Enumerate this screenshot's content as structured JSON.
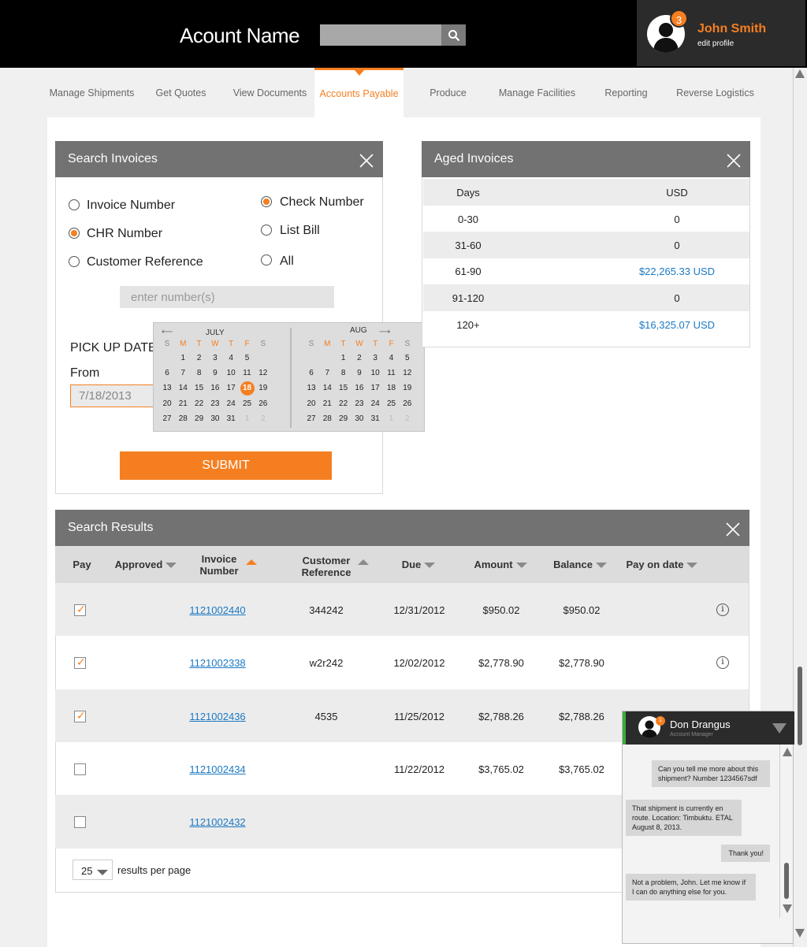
{
  "header": {
    "account_name": "Acount Name",
    "search_placeholder": "",
    "user_name": "John Smith",
    "edit_profile": "edit profile",
    "notification_count": "3"
  },
  "nav": {
    "items": [
      {
        "label": "Manage Shipments"
      },
      {
        "label": "Get Quotes"
      },
      {
        "label": "View Documents"
      },
      {
        "label": "Accounts Payable"
      },
      {
        "label": "Produce"
      },
      {
        "label": "Manage Facilities"
      },
      {
        "label": "Reporting"
      },
      {
        "label": "Reverse Logistics"
      }
    ],
    "active": "Accounts Payable"
  },
  "search_invoices": {
    "title": "Search Invoices",
    "options": [
      {
        "label": "Invoice Number",
        "selected": false
      },
      {
        "label": "CHR Number",
        "selected": true
      },
      {
        "label": "Customer Reference",
        "selected": false
      },
      {
        "label": "Check Number",
        "selected": true
      },
      {
        "label": "List Bill",
        "selected": false
      },
      {
        "label": "All",
        "selected": false
      }
    ],
    "number_placeholder": "enter number(s)",
    "pickup_label": "PICK UP DATE",
    "from_label": "From",
    "from_value": "7/18/2013",
    "submit_label": "SUBMIT"
  },
  "calendar": {
    "left": {
      "month": "JULY",
      "dow": [
        "S",
        "M",
        "T",
        "W",
        "T",
        "F",
        "S"
      ],
      "weeks": [
        [
          "",
          "1",
          "2",
          "3",
          "4",
          "5",
          ""
        ],
        [
          "6",
          "7",
          "8",
          "9",
          "10",
          "11",
          "12"
        ],
        [
          "13",
          "14",
          "15",
          "16",
          "17",
          "18",
          "19"
        ],
        [
          "20",
          "21",
          "22",
          "23",
          "24",
          "25",
          "26"
        ],
        [
          "27",
          "28",
          "29",
          "30",
          "31",
          "1",
          "2"
        ]
      ],
      "selected": "18"
    },
    "right": {
      "month": "AUG",
      "dow": [
        "S",
        "M",
        "T",
        "W",
        "T",
        "F",
        "S"
      ],
      "weeks": [
        [
          "",
          "",
          "",
          "1",
          "2",
          "3",
          "4",
          "5"
        ],
        [
          "6",
          "7",
          "8",
          "9",
          "10",
          "11",
          "12"
        ],
        [
          "13",
          "14",
          "15",
          "16",
          "17",
          "18",
          "19"
        ],
        [
          "20",
          "21",
          "22",
          "23",
          "24",
          "25",
          "26"
        ],
        [
          "27",
          "28",
          "29",
          "30",
          "31",
          "1",
          "2"
        ]
      ]
    }
  },
  "aged_invoices": {
    "title": "Aged Invoices",
    "col_days": "Days",
    "col_usd": "USD",
    "rows": [
      {
        "days": "0-30",
        "usd": "0",
        "link": false
      },
      {
        "days": "31-60",
        "usd": "0",
        "link": false
      },
      {
        "days": "61-90",
        "usd": "$22,265.33 USD",
        "link": true
      },
      {
        "days": "91-120",
        "usd": "0",
        "link": false
      },
      {
        "days": "120+",
        "usd": "$16,325.07 USD",
        "link": true
      }
    ]
  },
  "results": {
    "title": "Search Results",
    "headers": {
      "pay": "Pay",
      "approved": "Approved",
      "invoice_number": "Invoice Number",
      "customer_reference": "Customer Reference",
      "due": "Due",
      "amount": "Amount",
      "balance": "Balance",
      "pay_on_date": "Pay on date"
    },
    "rows": [
      {
        "checked": true,
        "invoice": "1121002440",
        "ref": "344242",
        "due": "12/31/2012",
        "amount": "$950.02",
        "balance": "$950.02"
      },
      {
        "checked": true,
        "invoice": "1121002338",
        "ref": "w2r242",
        "due": "12/02/2012",
        "amount": "$2,778.90",
        "balance": "$2,778.90"
      },
      {
        "checked": true,
        "invoice": "1121002436",
        "ref": "4535",
        "due": "11/25/2012",
        "amount": "$2,788.26",
        "balance": "$2,788.26"
      },
      {
        "checked": false,
        "invoice": "1121002434",
        "ref": "",
        "due": "11/22/2012",
        "amount": "$3,765.02",
        "balance": "$3,765.02"
      },
      {
        "checked": false,
        "invoice": "1121002432",
        "ref": "",
        "due": "",
        "amount": "",
        "balance": ""
      }
    ],
    "per_page_value": "25",
    "per_page_label": "results per page",
    "info_glyph": "i"
  },
  "chat": {
    "name": "Don Drangus",
    "role": "Account Manager",
    "badge": "1",
    "messages": [
      {
        "from": "user",
        "text": "Can you tell me more about this shipment? Number 1234567sdf"
      },
      {
        "from": "agent",
        "text": "That shipment is currently en route. Location: Timbuktu. ETAL August 8, 2013."
      },
      {
        "from": "user",
        "text": "Thank you!"
      },
      {
        "from": "agent",
        "text": "Not a problem, John. Let me know if I can do anything else for you."
      }
    ]
  },
  "colors": {
    "accent": "#f57f20",
    "link": "#1b79c4",
    "header_bg": "#000000",
    "panel_head": "#727272",
    "online": "#3cab3c"
  }
}
